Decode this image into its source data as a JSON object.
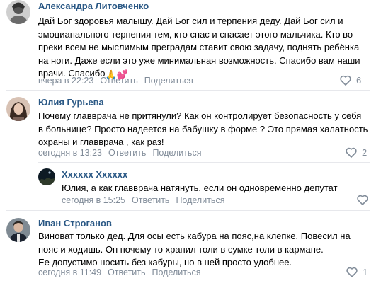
{
  "comments": [
    {
      "author": "Александра Литовченко",
      "lines": [
        "Дай Бог здоровья малышу. Дай Бог сил и терпения деду. Дай Бог сил и",
        "эмоцианального терпения тем, кто спас и спасает этого мальчика. Кто во",
        "преки всем не мыслимым преградам ставит свою задачу, поднять ребёнка",
        "на ноги. Даже если это уже минимальная возможность. Спасибо вам наши",
        "врачи. Спасибо"
      ],
      "emojis": [
        "🙏",
        "💕"
      ],
      "date": "вчера в 22:23",
      "reply": "Ответить",
      "share": "Поделиться",
      "likes": "6"
    },
    {
      "author": "Юлия Гурьева",
      "lines": [
        "Почему главврача не притянули? Как он контролирует безопасность у себя",
        "в больнице? Просто надеется на бабушку в форме ? Это прямая халатность",
        "охраны и главврача , как раз!"
      ],
      "date": "сегодня в 13:23",
      "reply": "Ответить",
      "share": "Поделиться",
      "likes": "2"
    },
    {
      "author": "Xxxxxx Xxxxxx",
      "lines": [
        "Юлия, а как главврача натянуть, если он одновременно депутат"
      ],
      "date": "сегодня в 15:25",
      "reply": "Ответить",
      "share": "Поделиться",
      "likes": ""
    },
    {
      "author": "Иван Строганов",
      "lines": [
        "Виноват только дед. Для осы есть кабура на пояс,на клепке. Повесил на",
        "пояс и ходишь. Он почему то хранил толи в сумке толи в кармане.",
        "Ее допустимо носить без кабуры, но в ней просто удобнее."
      ],
      "date": "сегодня в 11:49",
      "reply": "Ответить",
      "share": "Поделиться",
      "likes": "1"
    }
  ],
  "icons": {
    "like": "heart-icon"
  },
  "colors": {
    "author": "#2a5885",
    "meta": "#818c99",
    "separator": "#e7e8ec"
  }
}
